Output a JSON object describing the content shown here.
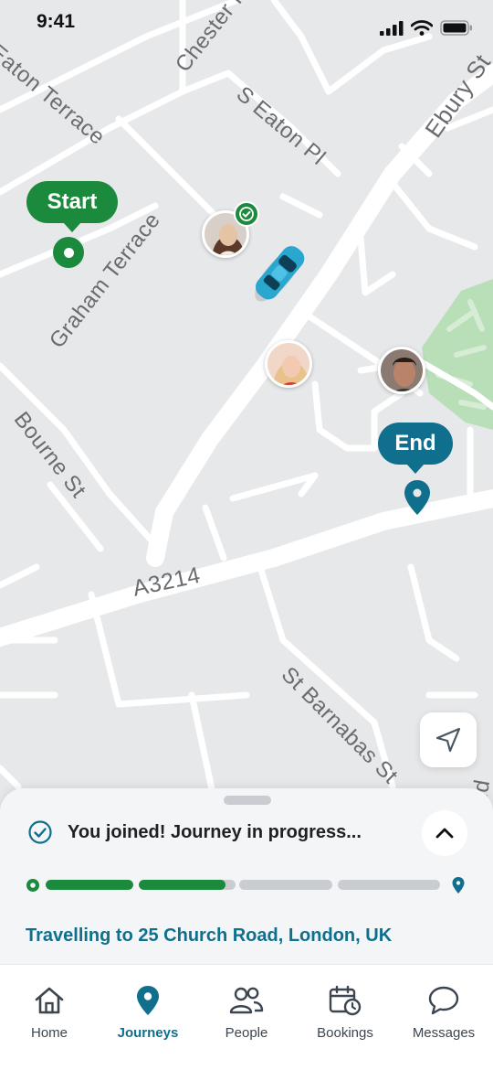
{
  "status_bar": {
    "time": "9:41"
  },
  "map": {
    "streets": [
      "Eaton Terrace",
      "Chester R",
      "S Eaton Pl",
      "Ebury St",
      "Graham Terrace",
      "Bourne St",
      "A3214",
      "St Barnabas St",
      "Rd"
    ],
    "start_label": "Start",
    "end_label": "End",
    "car_color": "#2aa7cf"
  },
  "sheet": {
    "status": "You joined! Journey in progress...",
    "journey_progress": 0.46,
    "destination": "Travelling to 25 Church Road, London, UK"
  },
  "tabs": [
    {
      "label": "Home",
      "icon": "home-icon",
      "active": false
    },
    {
      "label": "Journeys",
      "icon": "map-pin-icon",
      "active": true
    },
    {
      "label": "People",
      "icon": "people-icon",
      "active": false
    },
    {
      "label": "Bookings",
      "icon": "calendar-clock-icon",
      "active": false
    },
    {
      "label": "Messages",
      "icon": "chat-bubble-icon",
      "active": false
    }
  ],
  "colors": {
    "primary_green": "#1b8a3c",
    "accent_teal": "#0f6f8c",
    "park_green": "#b9dfb8",
    "map_bg": "#e7e8ea"
  }
}
